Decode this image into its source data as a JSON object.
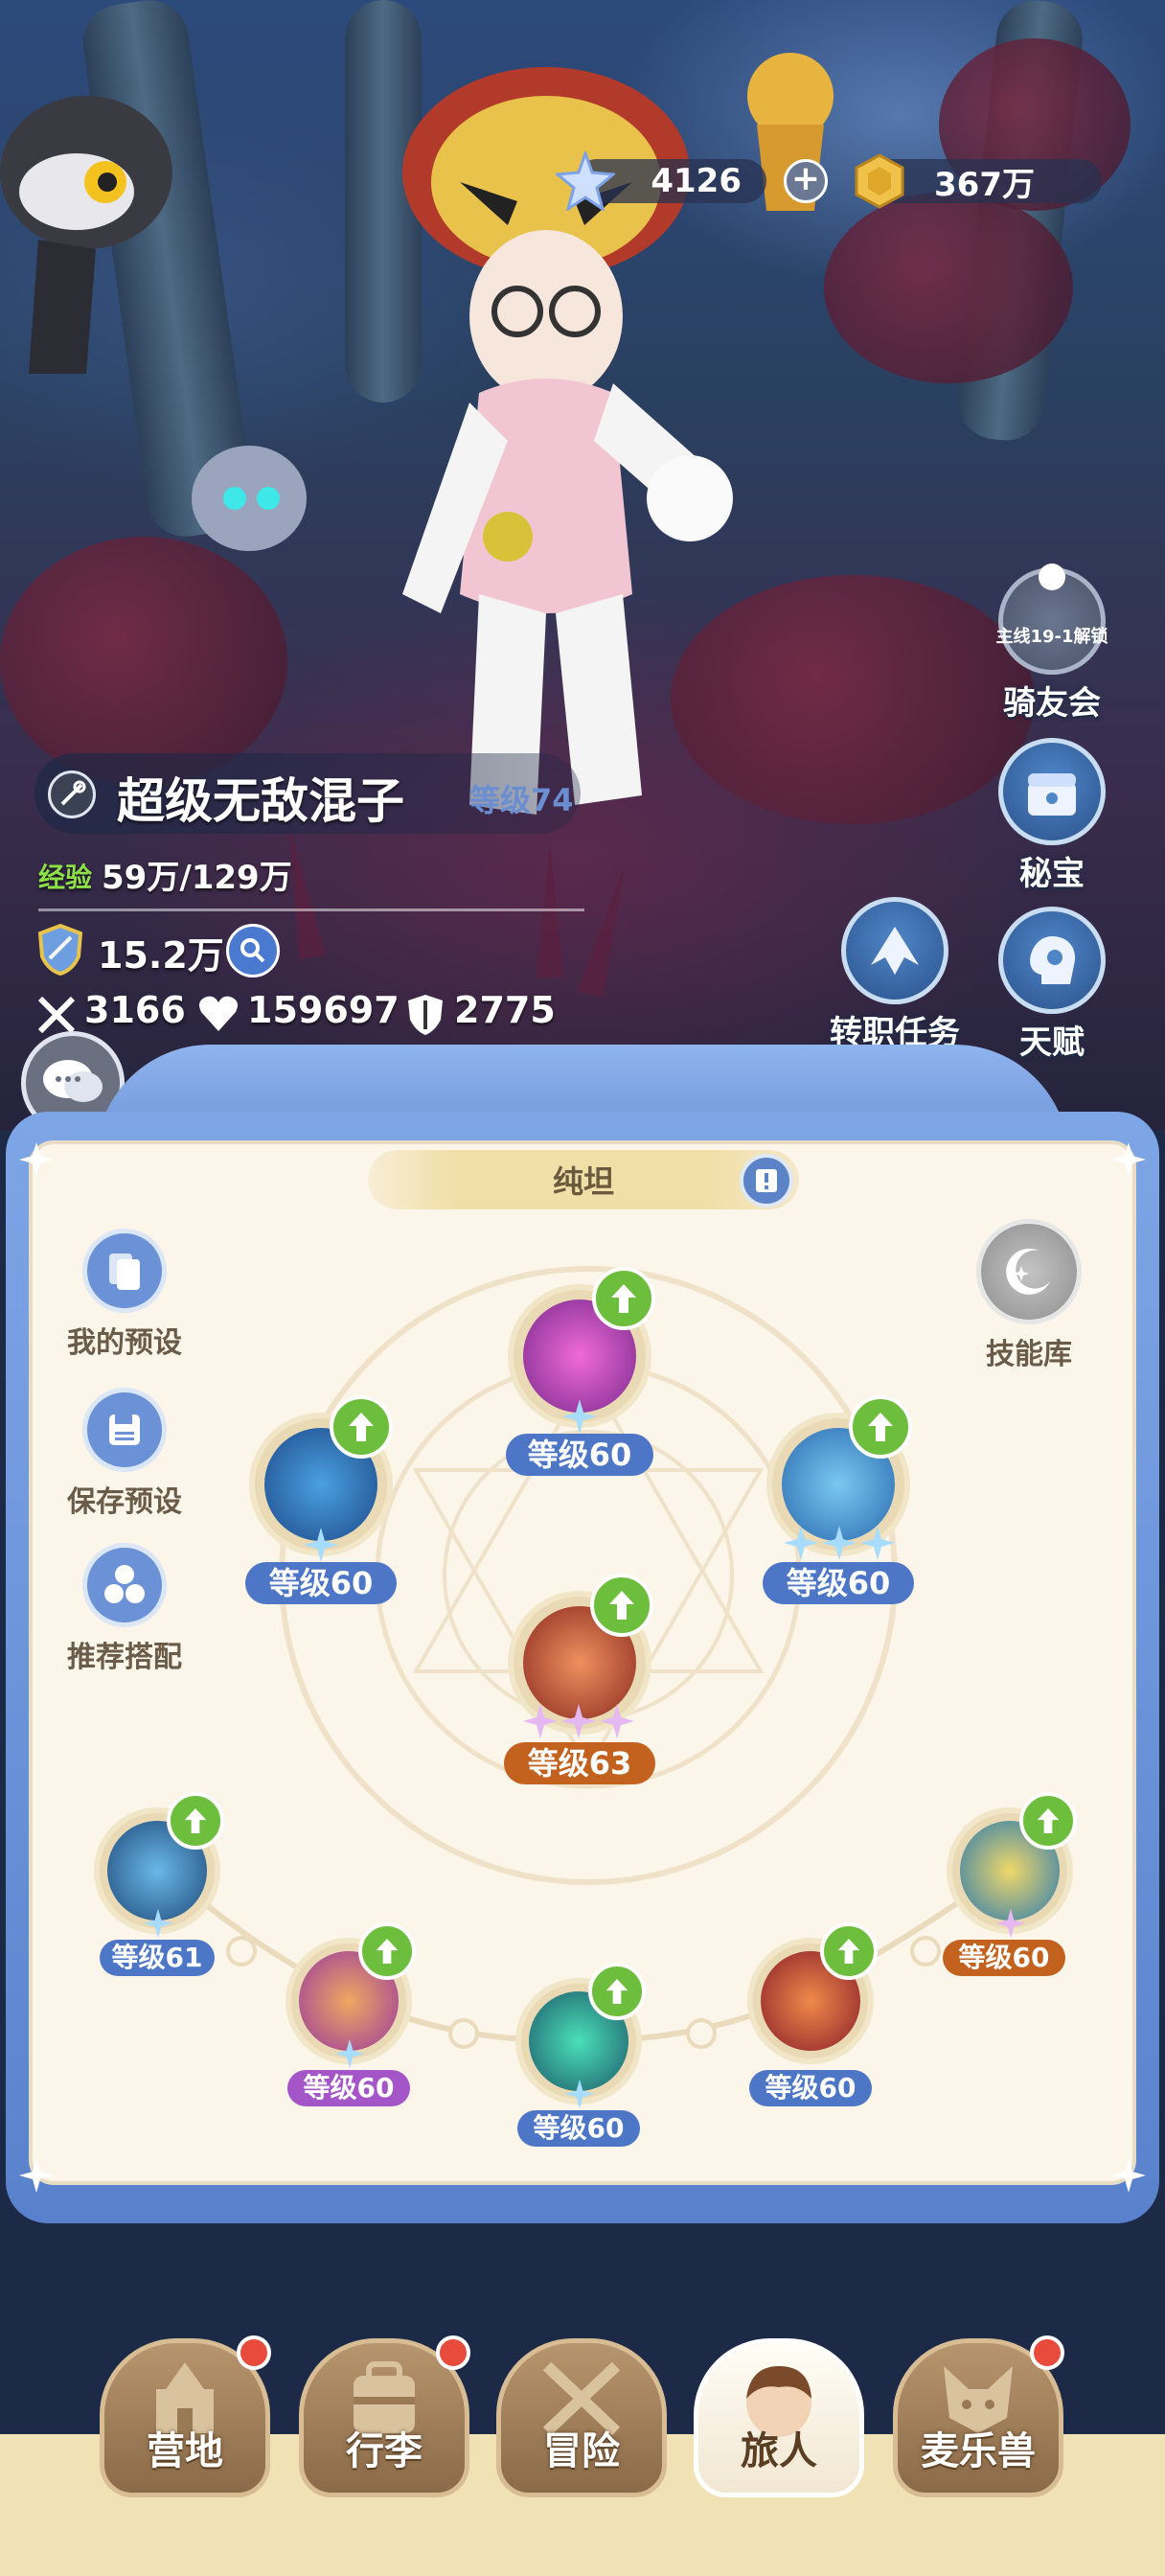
{
  "resources": {
    "gems": "4126",
    "coins": "367万"
  },
  "player": {
    "name": "超级无敌混子",
    "level": "等级74",
    "exp_label": "经验",
    "exp_value": "59万/129万",
    "power": "15.2万",
    "attack": "3166",
    "hp": "159697",
    "defense": "2775"
  },
  "side_buttons": {
    "knight_lock": "主线19-1解锁",
    "knight": "骑友会",
    "treasure": "秘宝",
    "job_quest": "转职任务",
    "talent": "天赋"
  },
  "panel": {
    "title": "纯坦",
    "my_presets": "我的预设",
    "save_preset": "保存预设",
    "recommend": "推荐搭配",
    "skill_library": "技能库"
  },
  "skills": {
    "top": "等级60",
    "left": "等级60",
    "right": "等级60",
    "center": "等级63",
    "b1": "等级61",
    "b2": "等级60",
    "b3": "等级60",
    "b4": "等级60",
    "b5": "等级60"
  },
  "nav": {
    "camp": "营地",
    "luggage": "行李",
    "adventure": "冒险",
    "traveler": "旅人",
    "pet": "麦乐兽"
  },
  "colors": {
    "panel_blue": "#6a90d4",
    "level_blue": "#4d76c6",
    "level_orange": "#c2621e",
    "level_purple": "#a455c8",
    "upgrade_green": "#6cbe3c",
    "badge_red": "#e84a3c"
  }
}
